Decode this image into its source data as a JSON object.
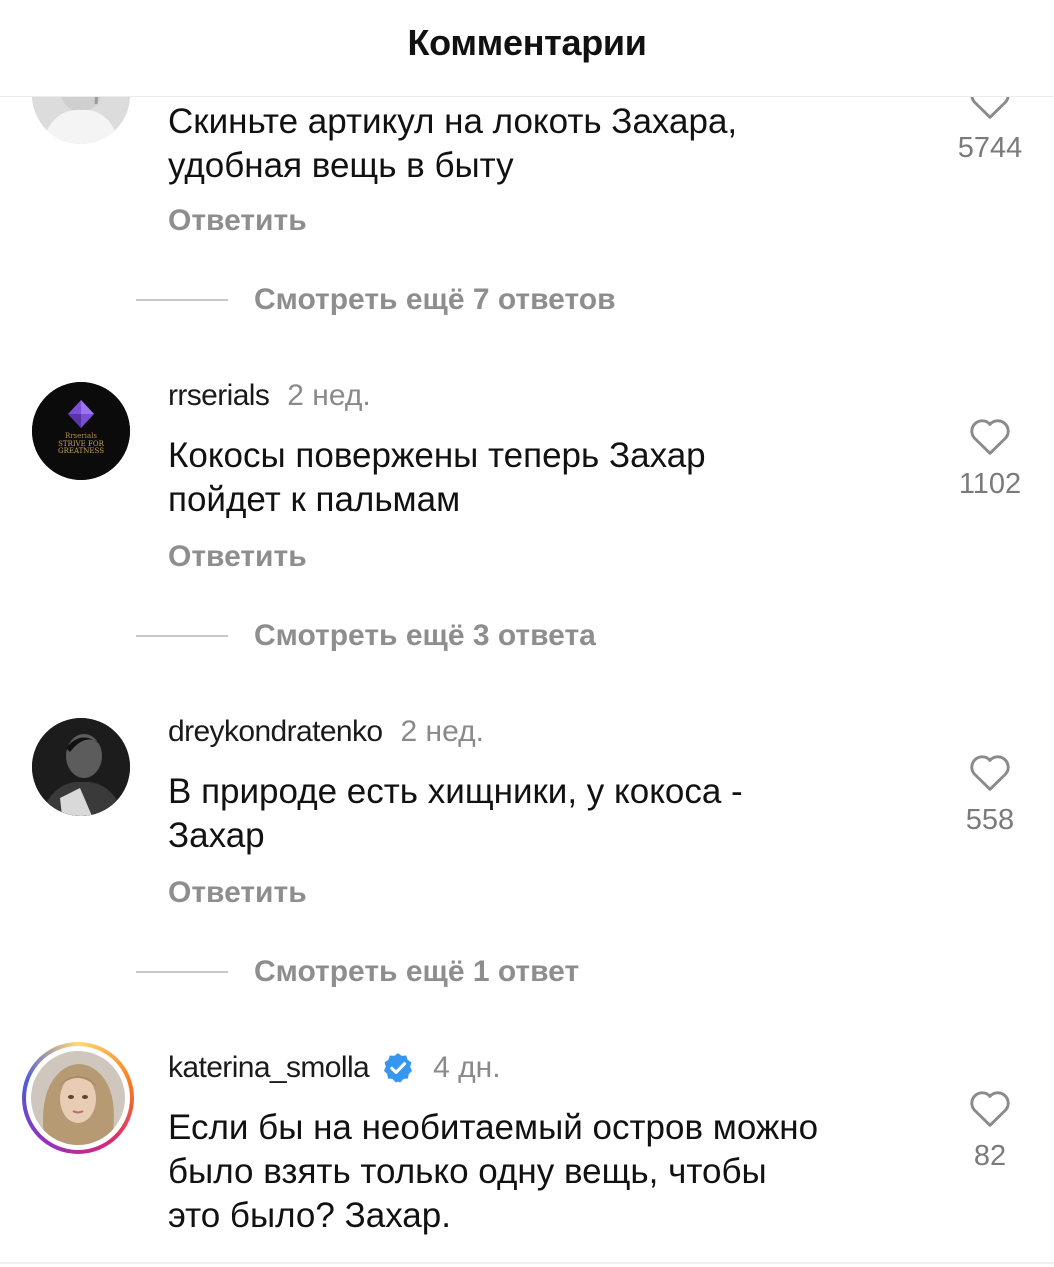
{
  "header": {
    "title": "Комментарии"
  },
  "comments": [
    {
      "username": "",
      "time": "",
      "text_lines": [
        "Скиньте артикул на локоть Захара,",
        "удобная вещь в быту"
      ],
      "likes": "5744",
      "reply_label": "Ответить",
      "more_replies": "Смотреть ещё 7 ответов",
      "avatar": "user-photo-avatar"
    },
    {
      "username": "rrserials",
      "time": "2 нед.",
      "text_lines": [
        "Кокосы повержены теперь Захар",
        "пойдет к пальмам"
      ],
      "likes": "1102",
      "reply_label": "Ответить",
      "more_replies": "Смотреть ещё 3 ответа",
      "avatar": "rrserials-logo-avatar",
      "avatar_text": [
        "Rrserials",
        "STRIVE FOR",
        "GREATNESS"
      ]
    },
    {
      "username": "dreykondratenko",
      "time": "2 нед.",
      "text_lines": [
        "В природе есть хищники, у кокоса -",
        "Захар"
      ],
      "likes": "558",
      "reply_label": "Ответить",
      "more_replies": "Смотреть ещё 1 ответ",
      "avatar": "user-photo-avatar"
    },
    {
      "username": "katerina_smolla",
      "time": "4 дн.",
      "verified": true,
      "text_lines": [
        "Если бы на необитаемый остров можно",
        "было взять только одну вещь, чтобы",
        "это было? Захар."
      ],
      "likes": "82",
      "avatar": "story-ring-photo-avatar"
    }
  ],
  "icons": {
    "like": "heart-outline-icon",
    "verified": "verified-badge-icon"
  },
  "colors": {
    "text": "#111111",
    "secondary": "#8e8e8e",
    "verified_blue": "#3797f0",
    "story_ring_start": "#feda75",
    "story_ring_mid": "#d62976",
    "story_ring_end": "#962fbf"
  }
}
